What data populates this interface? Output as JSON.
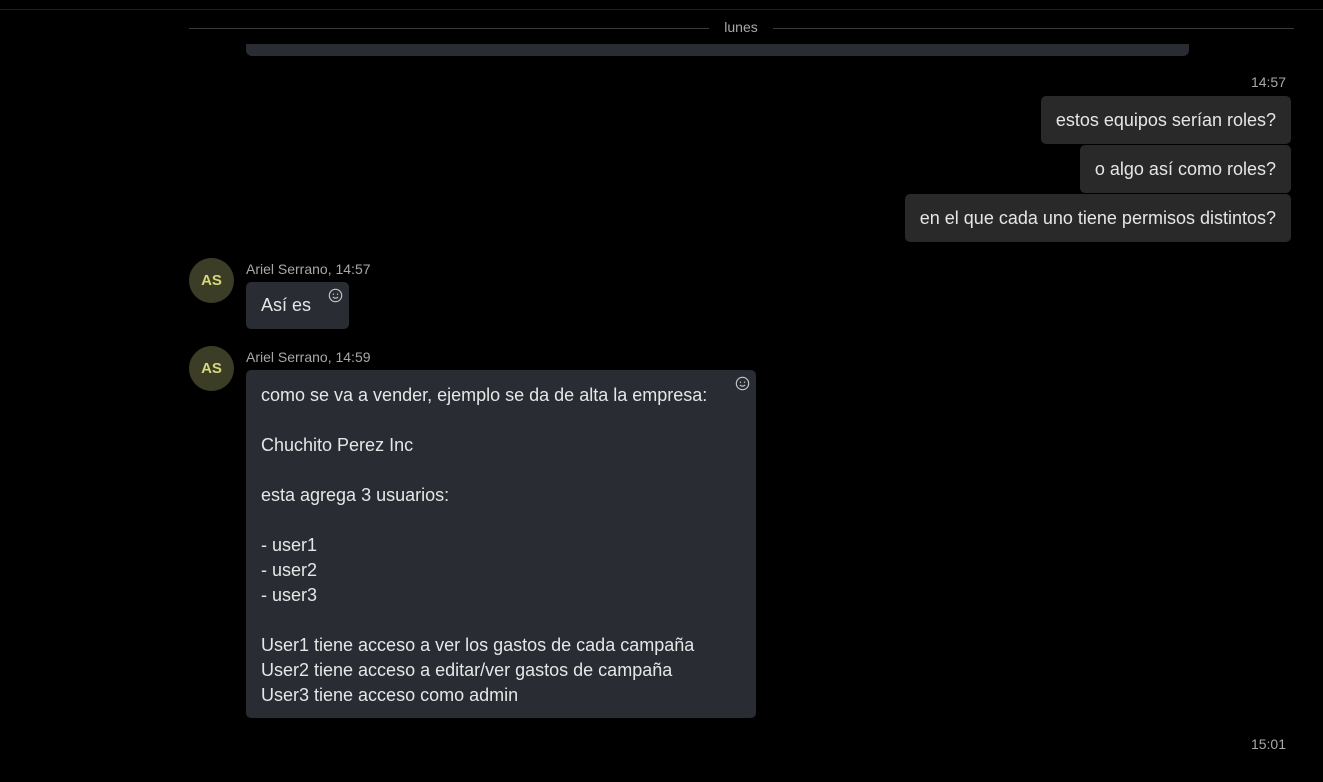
{
  "day_divider": {
    "label": "lunes"
  },
  "outgoing": {
    "time": "14:57",
    "messages": [
      "estos equipos serían roles?",
      "o algo así como roles?",
      "en el que cada uno tiene permisos distintos?"
    ]
  },
  "incoming": [
    {
      "avatar": "AS",
      "sender": "Ariel Serrano",
      "time": "14:57",
      "text": "Así es",
      "react_icon": "smiley-icon"
    },
    {
      "avatar": "AS",
      "sender": "Ariel Serrano",
      "time": "14:59",
      "lines": [
        "como se va a vender, ejemplo se da de alta la empresa:",
        "",
        "Chuchito Perez Inc",
        "",
        "esta agrega 3 usuarios:",
        "",
        "- user1",
        "- user2",
        "- user3",
        "",
        "User1 tiene acceso a ver los gastos de cada campaña",
        "User2 tiene acceso a editar/ver gastos de campaña",
        "User3 tiene acceso como admin"
      ],
      "react_icon": "smiley-icon"
    }
  ],
  "bottom_time": "15:01",
  "colors": {
    "background": "#000000",
    "outgoing_bubble": "#292929",
    "incoming_bubble": "#292d33",
    "avatar_bg": "#3b3d27",
    "avatar_text": "#d6d67a",
    "meta_text": "#a8a8a8",
    "message_text": "#e6e6e6"
  }
}
